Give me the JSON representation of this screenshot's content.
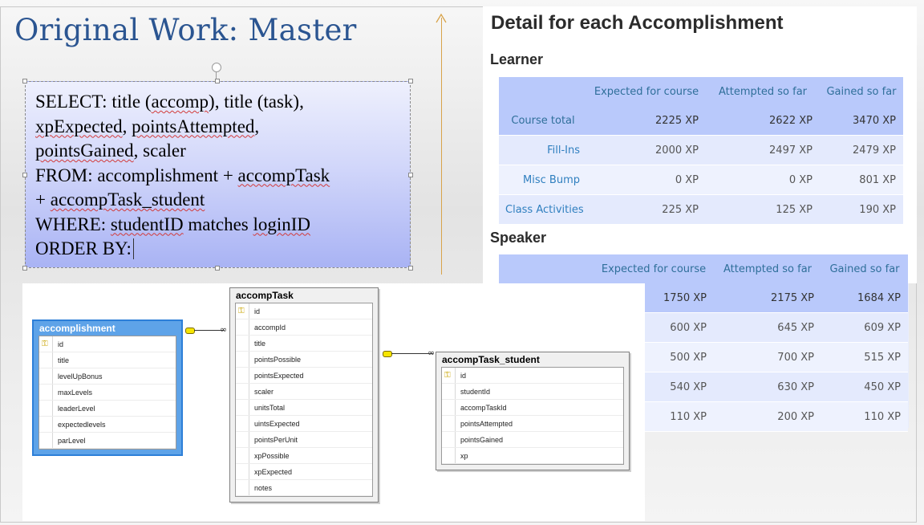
{
  "slide": {
    "title": "Original Work: Master",
    "sql_lines": [
      [
        "SELECT: title (",
        {
          "w": "accomp"
        },
        "), title (task),"
      ],
      [
        {
          "w": "xpExpected"
        },
        ", ",
        {
          "w": "pointsAttempted"
        },
        ","
      ],
      [
        {
          "w": "pointsGained"
        },
        ", scaler"
      ],
      [
        "FROM: accomplishment + ",
        {
          "w": "accompTask"
        }
      ],
      [
        "+ ",
        {
          "w": "accompTask_student"
        }
      ],
      [
        "WHERE: ",
        {
          "w": "studentID"
        },
        " matches ",
        {
          "w": "loginID"
        }
      ],
      [
        "ORDER BY:",
        {
          "cursor": true
        }
      ]
    ]
  },
  "detail": {
    "heading": "Detail for each Accomplishment",
    "learner": {
      "label": "Learner",
      "columns": [
        "",
        "Expected for course",
        "Attempted so far",
        "Gained so far"
      ],
      "rows": [
        {
          "label": "Course total",
          "vals": [
            "2225 XP",
            "2622 XP",
            "3470 XP"
          ],
          "kind": "tot"
        },
        {
          "label": "Fill-Ins",
          "vals": [
            "2000 XP",
            "2497 XP",
            "2479 XP"
          ],
          "kind": "alt"
        },
        {
          "label": "Misc Bump",
          "vals": [
            "0 XP",
            "0 XP",
            "801 XP"
          ],
          "kind": "plain"
        },
        {
          "label": "Class Activities",
          "vals": [
            "225 XP",
            "125 XP",
            "190 XP"
          ],
          "kind": "alt"
        }
      ]
    },
    "speaker": {
      "label": "Speaker",
      "columns": [
        "",
        "Expected for course",
        "Attempted so far",
        "Gained so far"
      ],
      "rows": [
        {
          "label": "",
          "vals": [
            "1750 XP",
            "2175 XP",
            "1684 XP"
          ],
          "kind": "tot"
        },
        {
          "label": "",
          "vals": [
            "600 XP",
            "645 XP",
            "609 XP"
          ],
          "kind": "alt"
        },
        {
          "label": "",
          "vals": [
            "500 XP",
            "700 XP",
            "515 XP"
          ],
          "kind": "plain"
        },
        {
          "label": "",
          "vals": [
            "540 XP",
            "630 XP",
            "450 XP"
          ],
          "kind": "alt"
        },
        {
          "label": "",
          "vals": [
            "110 XP",
            "200 XP",
            "110 XP"
          ],
          "kind": "plain"
        }
      ]
    }
  },
  "diagram": {
    "entities": [
      {
        "id": "accomplishment",
        "name": "accomplishment",
        "selected": true,
        "fields": [
          {
            "n": "id",
            "key": true
          },
          {
            "n": "title"
          },
          {
            "n": "levelUpBonus"
          },
          {
            "n": "maxLevels"
          },
          {
            "n": "leaderLevel"
          },
          {
            "n": "expectedlevels"
          },
          {
            "n": "parLevel"
          }
        ]
      },
      {
        "id": "accompTask",
        "name": "accompTask",
        "selected": false,
        "fields": [
          {
            "n": "id",
            "key": true
          },
          {
            "n": "accompId"
          },
          {
            "n": "title"
          },
          {
            "n": "pointsPossible"
          },
          {
            "n": "pointsExpected"
          },
          {
            "n": "scaler"
          },
          {
            "n": "unitsTotal"
          },
          {
            "n": "uintsExpected"
          },
          {
            "n": "pointsPerUnit"
          },
          {
            "n": "xpPossible"
          },
          {
            "n": "xpExpected"
          },
          {
            "n": "notes"
          }
        ]
      },
      {
        "id": "accompTask_student",
        "name": "accompTask_student",
        "selected": false,
        "fields": [
          {
            "n": "id",
            "key": true
          },
          {
            "n": "studentId"
          },
          {
            "n": "accompTaskId"
          },
          {
            "n": "pointsAttempted"
          },
          {
            "n": "pointsGained"
          },
          {
            "n": "xp"
          }
        ]
      }
    ],
    "key_glyph": "🔑",
    "infinity_glyph": "∞"
  }
}
